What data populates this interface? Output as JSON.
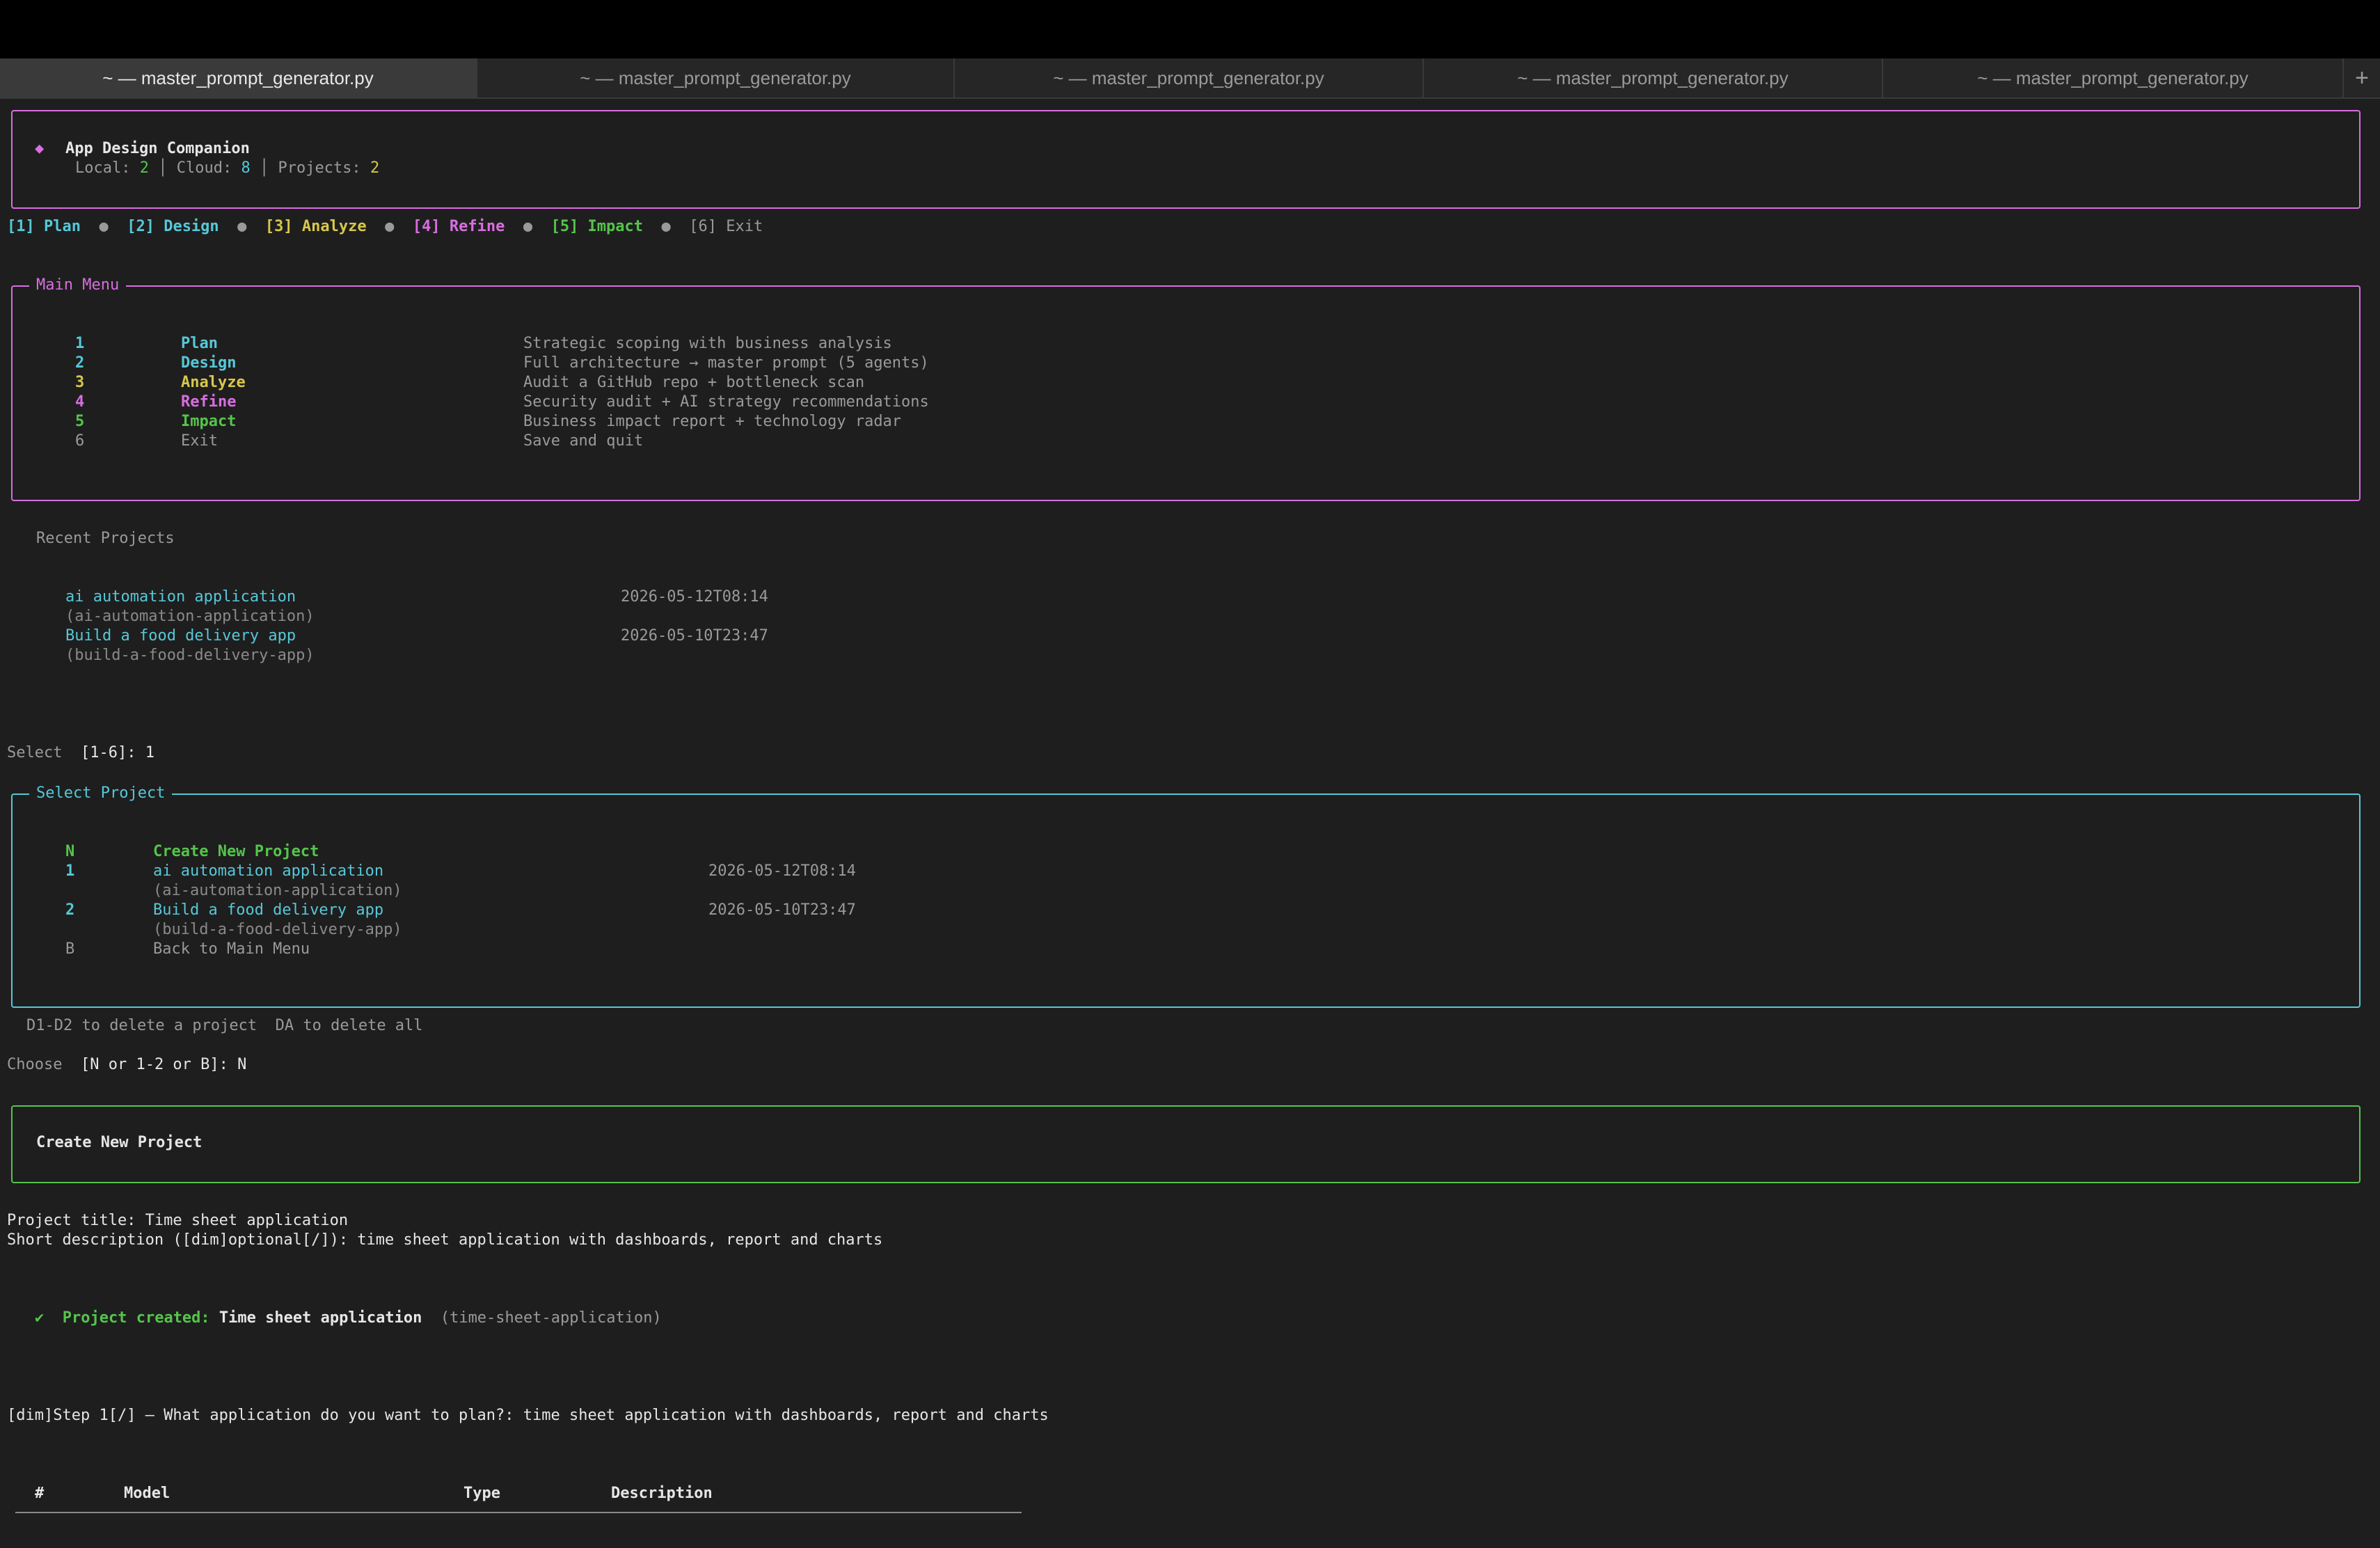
{
  "tabs": [
    {
      "label": "~ — master_prompt_generator.py",
      "active": true
    },
    {
      "label": "~ — master_prompt_generator.py",
      "active": false
    },
    {
      "label": "~ — master_prompt_generator.py",
      "active": false
    },
    {
      "label": "~ — master_prompt_generator.py",
      "active": false
    },
    {
      "label": "~ — master_prompt_generator.py",
      "active": false
    }
  ],
  "new_tab_label": "+",
  "header": {
    "diamond": "◆",
    "title": "App Design Companion",
    "local_label": "Local:",
    "local_value": "2",
    "cloud_label": "Cloud:",
    "cloud_value": "8",
    "projects_label": "Projects:",
    "projects_value": "2",
    "separator": "│"
  },
  "nav": {
    "items": [
      "[1] Plan",
      "[2] Design",
      "[3] Analyze",
      "[4] Refine",
      "[5] Impact",
      "[6] Exit"
    ],
    "bullet": "●"
  },
  "main_menu": {
    "title": "Main Menu",
    "items": [
      {
        "num": "1",
        "name": "Plan",
        "desc": "Strategic scoping with business analysis"
      },
      {
        "num": "2",
        "name": "Design",
        "desc": "Full architecture → master prompt (5 agents)"
      },
      {
        "num": "3",
        "name": "Analyze",
        "desc": "Audit a GitHub repo + bottleneck scan"
      },
      {
        "num": "4",
        "name": "Refine",
        "desc": "Security audit + AI strategy recommendations"
      },
      {
        "num": "5",
        "name": "Impact",
        "desc": "Business impact report + technology radar"
      },
      {
        "num": "6",
        "name": "Exit",
        "desc": "Save and quit"
      }
    ]
  },
  "recent": {
    "title": "Recent Projects",
    "items": [
      {
        "name": "ai automation application",
        "slug": "(ai-automation-application)",
        "date": "2026-05-12T08:14"
      },
      {
        "name": "Build a food delivery app",
        "slug": "(build-a-food-delivery-app)",
        "date": "2026-05-10T23:47"
      }
    ]
  },
  "select_prompt": {
    "label": "Select",
    "options": "[1-6]:",
    "value": "1"
  },
  "select_project": {
    "title": "Select Project",
    "new_key": "N",
    "new_label": "Create New Project",
    "items": [
      {
        "num": "1",
        "name": "ai automation application",
        "slug": "(ai-automation-application)",
        "date": "2026-05-12T08:14"
      },
      {
        "num": "2",
        "name": "Build a food delivery app",
        "slug": "(build-a-food-delivery-app)",
        "date": "2026-05-10T23:47"
      }
    ],
    "back_key": "B",
    "back_label": "Back to Main Menu"
  },
  "delete_hint": "D1-D2 to delete a project  DA to delete all",
  "choose_prompt": {
    "label": "Choose",
    "options": "[N or 1-2 or B]:",
    "value": "N"
  },
  "create_box": {
    "title": "Create New Project"
  },
  "project_title_line": "Project title: Time sheet application",
  "short_desc_line": "Short description ([dim]optional[/]): time sheet application with dashboards, report and charts",
  "created": {
    "check": "✔",
    "label": "Project created:",
    "name": "Time sheet application",
    "slug": "(time-sheet-application)"
  },
  "step_line": "[dim]Step 1[/] — What application do you want to plan?: time sheet application with dashboards, report and charts",
  "table": {
    "headers": [
      "#",
      "Model",
      "Type",
      "Description"
    ]
  },
  "colors": {
    "cyan": "#56c8d8",
    "magenta": "#d86ee0",
    "yellow": "#d6c84a",
    "green": "#55c44c",
    "background": "#1e1e1e"
  }
}
